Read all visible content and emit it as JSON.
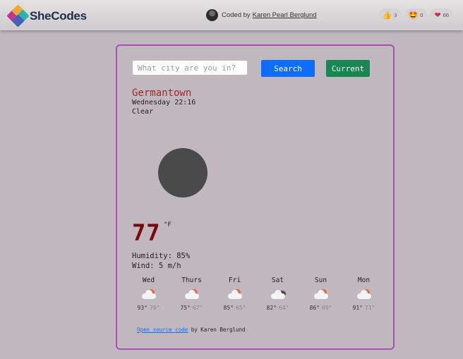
{
  "header": {
    "logo_text": "SheCodes",
    "coded_by_prefix": "Coded by",
    "coded_by_name": "Karen Pearl Berglund",
    "reactions": [
      {
        "icon": "thumbs-up-icon",
        "glyph": "👍",
        "count": "3"
      },
      {
        "icon": "star-struck-icon",
        "glyph": "🤩",
        "count": "0"
      },
      {
        "icon": "heart-icon",
        "glyph": "❤",
        "count": "66"
      }
    ]
  },
  "search": {
    "placeholder": "What city are you in?",
    "value": "",
    "search_label": "Search",
    "current_label": "Current"
  },
  "weather": {
    "city": "Germantown",
    "datetime": "Wednesday 22:16",
    "description": "Clear",
    "temperature": "77",
    "unit": "°F",
    "humidity": "Humidity: 85%",
    "wind": "Wind: 5 m/h"
  },
  "forecast": [
    {
      "day": "Wed",
      "icon": "partly-cloudy-icon",
      "high": "93°",
      "low": "70°"
    },
    {
      "day": "Thurs",
      "icon": "partly-cloudy-icon",
      "high": "75°",
      "low": "67°"
    },
    {
      "day": "Fri",
      "icon": "partly-cloudy-icon",
      "high": "85°",
      "low": "65°"
    },
    {
      "day": "Sat",
      "icon": "cloudy-icon",
      "high": "82°",
      "low": "64°"
    },
    {
      "day": "Sun",
      "icon": "partly-cloudy-icon",
      "high": "86°",
      "low": "69°"
    },
    {
      "day": "Mon",
      "icon": "partly-cloudy-icon",
      "high": "91°",
      "low": "71°"
    }
  ],
  "footer": {
    "link_text": "Open source code",
    "suffix": "by Karen Berglund"
  },
  "colors": {
    "accent_border": "#a84fb8",
    "search_button": "#0d6efd",
    "current_button": "#198754",
    "city": "#a3262a",
    "temperature": "#7a0a0a"
  }
}
